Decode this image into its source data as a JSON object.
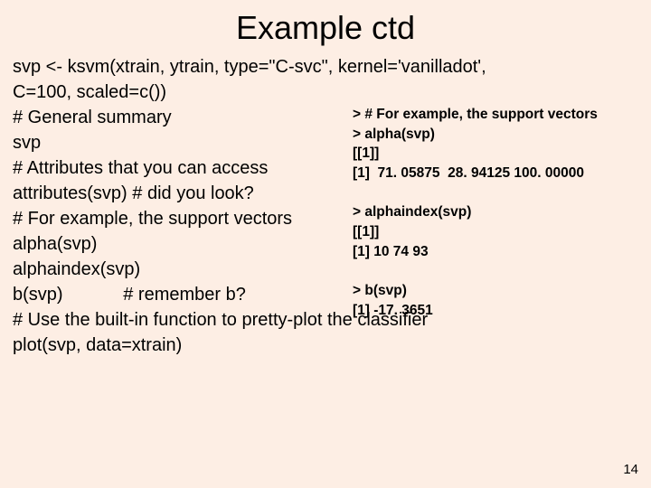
{
  "title": "Example ctd",
  "left": "svp <- ksvm(xtrain, ytrain, type=\"C-svc\", kernel='vanilladot',\nC=100, scaled=c())\n# General summary\nsvp\n# Attributes that you can access\nattributes(svp) # did you look?\n# For example, the support vectors\nalpha(svp)\nalphaindex(svp)\nb(svp)            # remember b?\n# Use the built-in function to pretty-plot the classifier\nplot(svp, data=xtrain)",
  "right": "> # For example, the support vectors\n> alpha(svp)\n[[1]]\n[1]  71. 05875  28. 94125 100. 00000\n\n> alphaindex(svp)\n[[1]]\n[1] 10 74 93\n\n> b(svp)\n[1] -17. 3651",
  "pagenum": "14"
}
